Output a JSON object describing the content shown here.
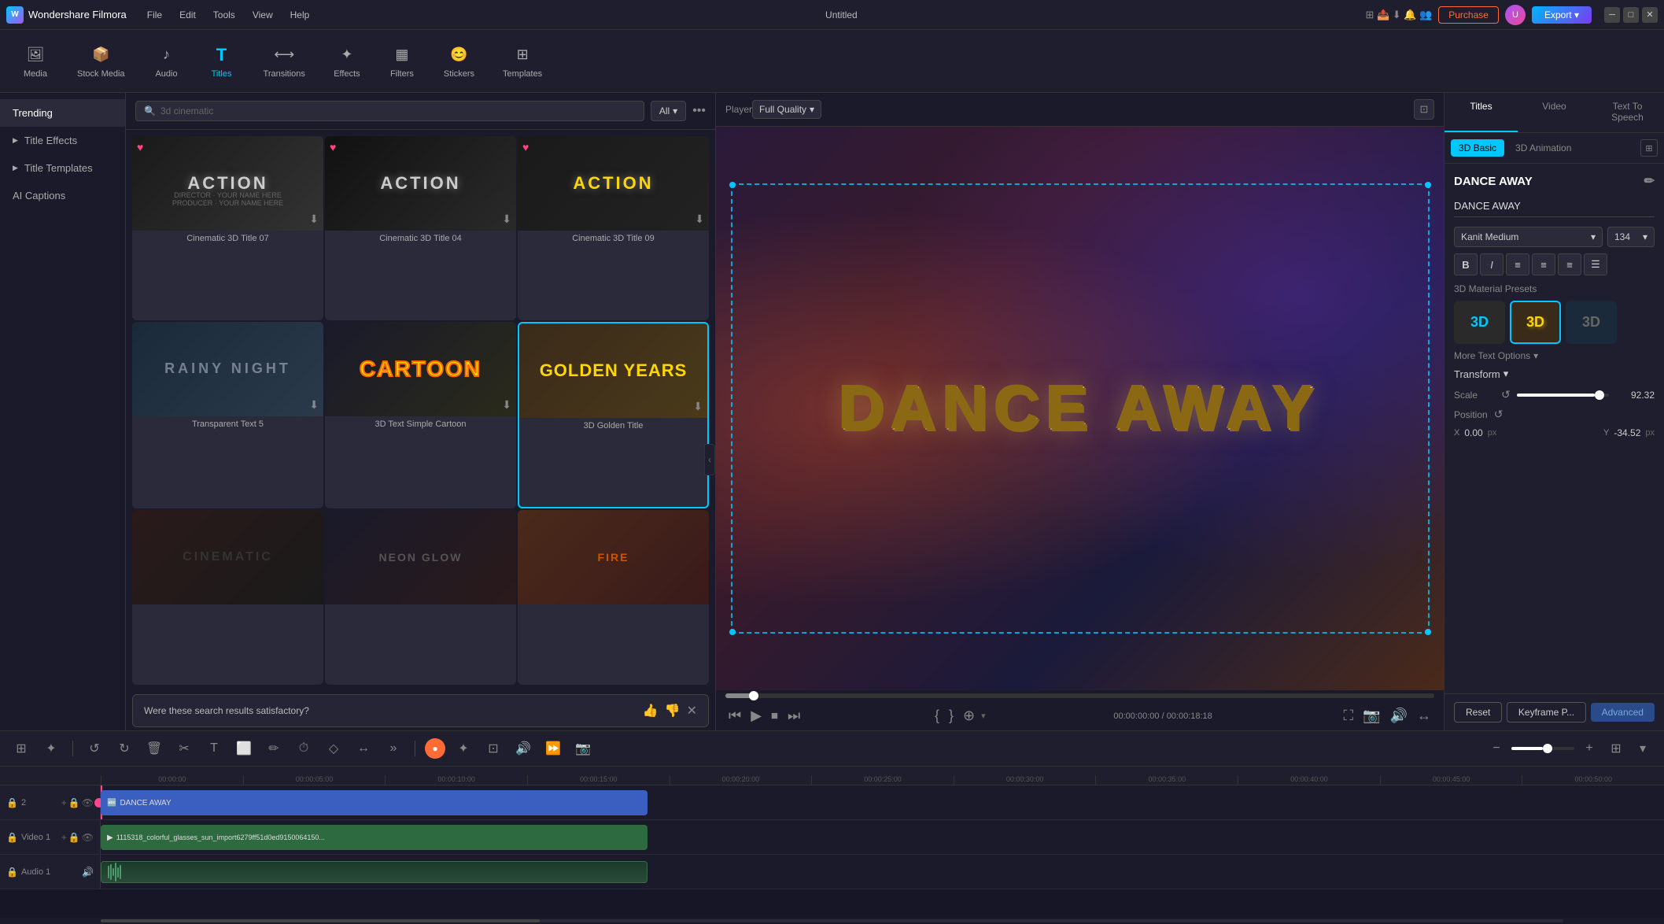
{
  "app": {
    "name": "Wondershare Filmora",
    "title": "Untitled",
    "purchase_label": "Purchase",
    "export_label": "Export ▾"
  },
  "menu": {
    "items": [
      "File",
      "Edit",
      "Tools",
      "View",
      "Help"
    ]
  },
  "toolbar": {
    "items": [
      {
        "id": "media",
        "label": "Media",
        "icon": "🖼"
      },
      {
        "id": "stock",
        "label": "Stock Media",
        "icon": "📦"
      },
      {
        "id": "audio",
        "label": "Audio",
        "icon": "🎵"
      },
      {
        "id": "titles",
        "label": "Titles",
        "icon": "T",
        "active": true
      },
      {
        "id": "transitions",
        "label": "Transitions",
        "icon": "⟷"
      },
      {
        "id": "effects",
        "label": "Effects",
        "icon": "✨"
      },
      {
        "id": "filters",
        "label": "Filters",
        "icon": "🔲"
      },
      {
        "id": "stickers",
        "label": "Stickers",
        "icon": "😊"
      },
      {
        "id": "templates",
        "label": "Templates",
        "icon": "⊞"
      }
    ]
  },
  "sidebar": {
    "items": [
      {
        "id": "trending",
        "label": "Trending",
        "active": true
      },
      {
        "id": "title-effects",
        "label": "Title Effects",
        "hasArrow": true
      },
      {
        "id": "title-templates",
        "label": "Title Templates",
        "hasArrow": true
      },
      {
        "id": "ai-captions",
        "label": "AI Captions"
      }
    ]
  },
  "search": {
    "placeholder": "3d cinematic",
    "filter_label": "All"
  },
  "cards": [
    {
      "id": "c1",
      "label": "Cinematic 3D Title 07",
      "type": "action",
      "text": "ACTION",
      "heart": true
    },
    {
      "id": "c2",
      "label": "Cinematic 3D Title 04",
      "type": "action2",
      "text": "ACTION",
      "heart": true
    },
    {
      "id": "c3",
      "label": "Cinematic 3D Title 09",
      "type": "action3",
      "text": "ACTION",
      "heart": true
    },
    {
      "id": "c4",
      "label": "Transparent Text 5",
      "type": "rainy",
      "text": "RAINY NIGHT"
    },
    {
      "id": "c5",
      "label": "3D Text Simple Cartoon",
      "type": "cartoon",
      "text": "CARTOON"
    },
    {
      "id": "c6",
      "label": "3D Golden Title",
      "type": "golden",
      "text": "GOLDEN YEARS",
      "selected": true
    },
    {
      "id": "c7",
      "label": "",
      "type": "dark1",
      "text": ""
    },
    {
      "id": "c8",
      "label": "",
      "type": "dark2",
      "text": ""
    },
    {
      "id": "c9",
      "label": "",
      "type": "fire",
      "text": ""
    }
  ],
  "satisfaction": {
    "text": "Were these search results satisfactory?"
  },
  "player": {
    "label": "Player",
    "quality": "Full Quality",
    "time_current": "00:00:00:00",
    "time_total": "00:00:18:18",
    "dance_text": "DANCE AWAY"
  },
  "right_panel": {
    "tabs": [
      "Titles",
      "Video",
      "Text To Speech"
    ],
    "sub_tabs": [
      "3D Basic",
      "3D Animation"
    ],
    "title_name": "DANCE AWAY",
    "title_text": "DANCE AWAY",
    "font": "Kanit Medium",
    "font_size": "134",
    "section_3d_label": "3D Material Presets",
    "more_options": "More Text Options",
    "transform_label": "Transform",
    "scale_label": "Scale",
    "scale_value": "92.32",
    "position_label": "Position",
    "x_label": "X",
    "x_value": "0.00",
    "x_unit": "px",
    "y_label": "Y",
    "y_value": "-34.52",
    "y_unit": "px",
    "presets": [
      {
        "label": "3D",
        "style": "blue"
      },
      {
        "label": "3D",
        "style": "golden",
        "selected": true
      },
      {
        "label": "3D",
        "style": "gray"
      }
    ]
  },
  "panel_buttons": {
    "reset": "Reset",
    "keyframe": "Keyframe P...",
    "advanced": "Advanced"
  },
  "timeline": {
    "tracks": [
      {
        "id": "v2",
        "label": "2",
        "type": "video",
        "clips": [
          {
            "label": "🔤 DANCE AWAY",
            "type": "title",
            "style": "clip-title"
          }
        ]
      },
      {
        "id": "v1",
        "label": "Video 1",
        "type": "video",
        "clips": [
          {
            "label": "1115318_colorful_glasses_sun_import6279ff51d0ed9150064150...",
            "type": "video",
            "style": "clip-video"
          }
        ]
      },
      {
        "id": "a1",
        "label": "Audio 1",
        "type": "audio",
        "clips": [
          {
            "label": "",
            "type": "audio",
            "style": "clip-audio"
          }
        ]
      }
    ],
    "ruler_marks": [
      "00:00:00",
      "00:00:05:00",
      "00:00:10:00",
      "00:00:15:00",
      "00:00:20:00",
      "00:00:25:00",
      "00:00:30:00",
      "00:00:35:00",
      "00:00:40:00",
      "00:00:45:00",
      "00:00:50:00"
    ]
  }
}
